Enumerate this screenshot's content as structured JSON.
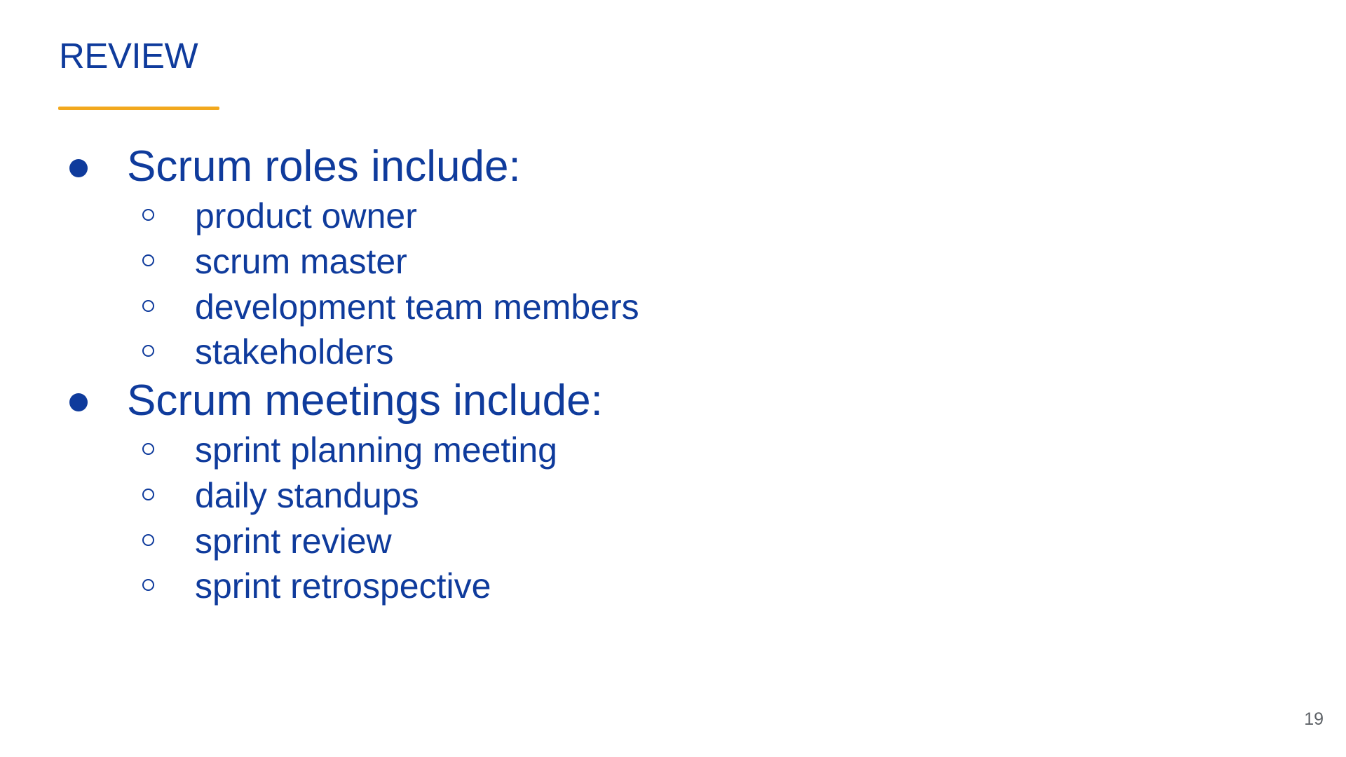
{
  "slide": {
    "title": "REVIEW",
    "accent_color": "#f2a81d",
    "text_color": "#0f3b9c",
    "page_number": "19"
  },
  "outline": [
    {
      "label": "Scrum roles include:",
      "items": [
        "product owner",
        "scrum master",
        "development team members",
        "stakeholders"
      ]
    },
    {
      "label": "Scrum meetings include:",
      "items": [
        "sprint planning meeting",
        "daily standups",
        "sprint review",
        "sprint retrospective"
      ]
    }
  ]
}
